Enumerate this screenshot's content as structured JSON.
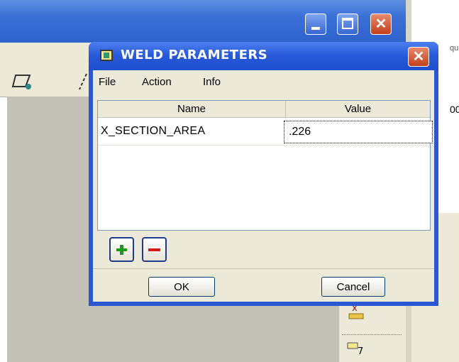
{
  "dialog": {
    "title": "WELD PARAMETERS",
    "close_glyph": "✕"
  },
  "menu": {
    "file": "File",
    "action": "Action",
    "info": "Info"
  },
  "table": {
    "headers": {
      "name": "Name",
      "value": "Value"
    },
    "rows": [
      {
        "name": "X_SECTION_AREA",
        "value": ".226"
      }
    ]
  },
  "buttons": {
    "add_icon": "plus-icon",
    "remove_icon": "minus-icon",
    "ok": "OK",
    "cancel": "Cancel"
  },
  "background": {
    "side_text_top": "qu",
    "side_text_mid": "00"
  },
  "colors": {
    "titlebar": "#2d57d0",
    "close": "#c3401c",
    "dialog_face": "#ece9d8",
    "add": "#1a9a1a",
    "remove": "#d41a1a"
  }
}
